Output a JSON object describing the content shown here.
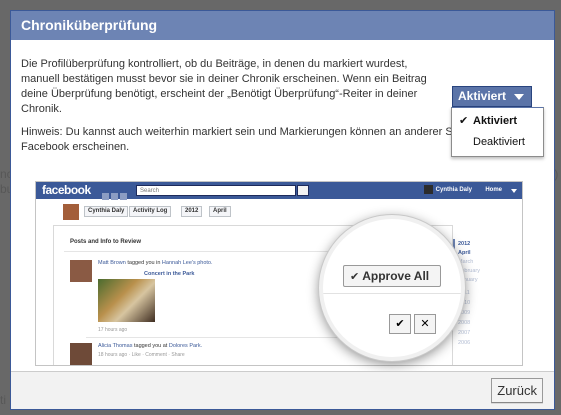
{
  "dialog": {
    "title": "Chroniküberprüfung",
    "description": "Die Profilüberprüfung kontrolliert, ob du Beiträge, in denen du markiert wurdest, manuell bestätigen musst bevor sie in deiner Chronik erscheinen. Wenn ein Beitrag deine Überprüfung benötigt, erscheint der „Benötigt Überprüfung“-Reiter in deiner Chronik.",
    "hint_line1": "Hinweis: Du kannst auch weiterhin markiert sein und Markierungen können an anderer S",
    "hint_line2": "Facebook erscheinen.",
    "status_button_label": "Aktiviert",
    "menu": {
      "items": [
        {
          "label": "Aktiviert",
          "selected": true
        },
        {
          "label": "Deaktiviert",
          "selected": false
        }
      ]
    },
    "back_button_label": "Zurück"
  },
  "preview": {
    "logo": "facebook",
    "search_placeholder": "Search",
    "user_name": "Cynthia Daly",
    "home_label": "Home",
    "toolbar": {
      "name_label": "Cynthia Daly",
      "activity_log_label": "Activity Log",
      "year_label": "2012",
      "month_label": "April"
    },
    "panel_title": "Posts and Info to Review",
    "story1": {
      "actor": "Matt Brown",
      "middle": " tagged you in ",
      "owner": "Hannah Lee's photo.",
      "link": "Concert in the Park",
      "time": "17 hours ago"
    },
    "story2": {
      "actor": "Alicia Thomas",
      "middle": " tagged you at ",
      "place": "Dolores Park.",
      "meta": "18 hours ago · Like · Comment · Share"
    },
    "timeline": [
      "2012",
      "April",
      "March",
      "February",
      "January",
      "2011",
      "2010",
      "2009",
      "2008",
      "2007",
      "2006"
    ],
    "magnifier": {
      "approve_all_label": "Approve All",
      "check_glyph": "✔",
      "x_glyph": "✕"
    }
  },
  "background": {
    "fragments": [
      "nc",
      "bu",
      "ti",
      "/)"
    ]
  },
  "colors": {
    "title_bar": "#6d84b4",
    "facebook_blue": "#3b5998",
    "status_button": "#5b74a8"
  }
}
